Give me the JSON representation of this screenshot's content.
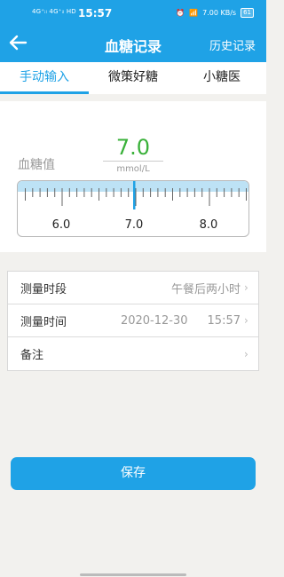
{
  "status_bar": {
    "left_indicators": "4G⁺ᵢₗ 4G⁺ᵢₗ HD",
    "time": "15:57",
    "right_indicators": "7.00 KB/s",
    "battery": "61"
  },
  "header": {
    "title": "血糖记录",
    "history_label": "历史记录"
  },
  "tabs": [
    {
      "label": "手动输入",
      "active": true
    },
    {
      "label": "微策好糖",
      "active": false
    },
    {
      "label": "小糖医",
      "active": false
    }
  ],
  "glucose": {
    "label": "血糖值",
    "value": "7.0",
    "unit": "mmol/L",
    "ruler_ticks": [
      "6.0",
      "7.0",
      "8.0"
    ]
  },
  "form": {
    "period_label": "测量时段",
    "period_value": "午餐后两小时",
    "time_label": "测量时间",
    "date_value": "2020-12-30",
    "time_value": "15:57",
    "note_label": "备注"
  },
  "save_label": "保存",
  "colors": {
    "accent": "#1fa2e6",
    "value_green": "#3ab13a"
  }
}
